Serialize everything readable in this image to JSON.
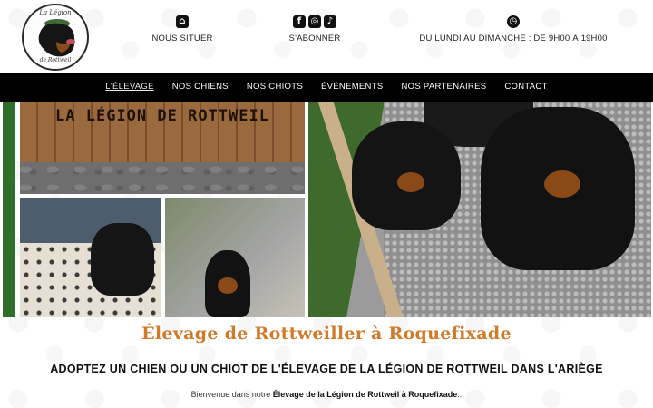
{
  "logo": {
    "top_text": "La Légion",
    "bottom_text": "de Rottweil"
  },
  "topbar": {
    "locate": {
      "icon": "store-icon",
      "label": "NOUS SITUER"
    },
    "subscribe": {
      "icons": [
        "facebook-icon",
        "instagram-icon",
        "tiktok-icon"
      ],
      "label": "S'ABONNER"
    },
    "hours": {
      "icon": "clock-icon",
      "label": "DU LUNDI AU DIMANCHE : DE 9H00 À 19H00"
    }
  },
  "nav": {
    "items": [
      "L'ÉLEVAGE",
      "NOS CHIENS",
      "NOS CHIOTS",
      "ÉVÉNEMENTS",
      "NOS PARTENAIRES",
      "CONTACT"
    ],
    "active_index": 0
  },
  "gallery": {
    "sign_text": "LA LÉGION DE ROTTWEIL"
  },
  "content": {
    "title": "Élevage de Rottweiller à Roquefixade",
    "subtitle": "ADOPTEZ UN CHIEN OU UN CHIOT DE L'ÉLEVAGE DE LA LÉGION DE ROTTWEIL DANS L'ARIÈGE",
    "intro_prefix": "Bienvenue dans notre ",
    "intro_bold": "Élevage de la Légion de Rottweil à Roquefixade",
    "intro_suffix": ".."
  },
  "colors": {
    "accent": "#d07a2a",
    "nav_bg": "#000000",
    "green_bar": "#2f6f2a"
  }
}
